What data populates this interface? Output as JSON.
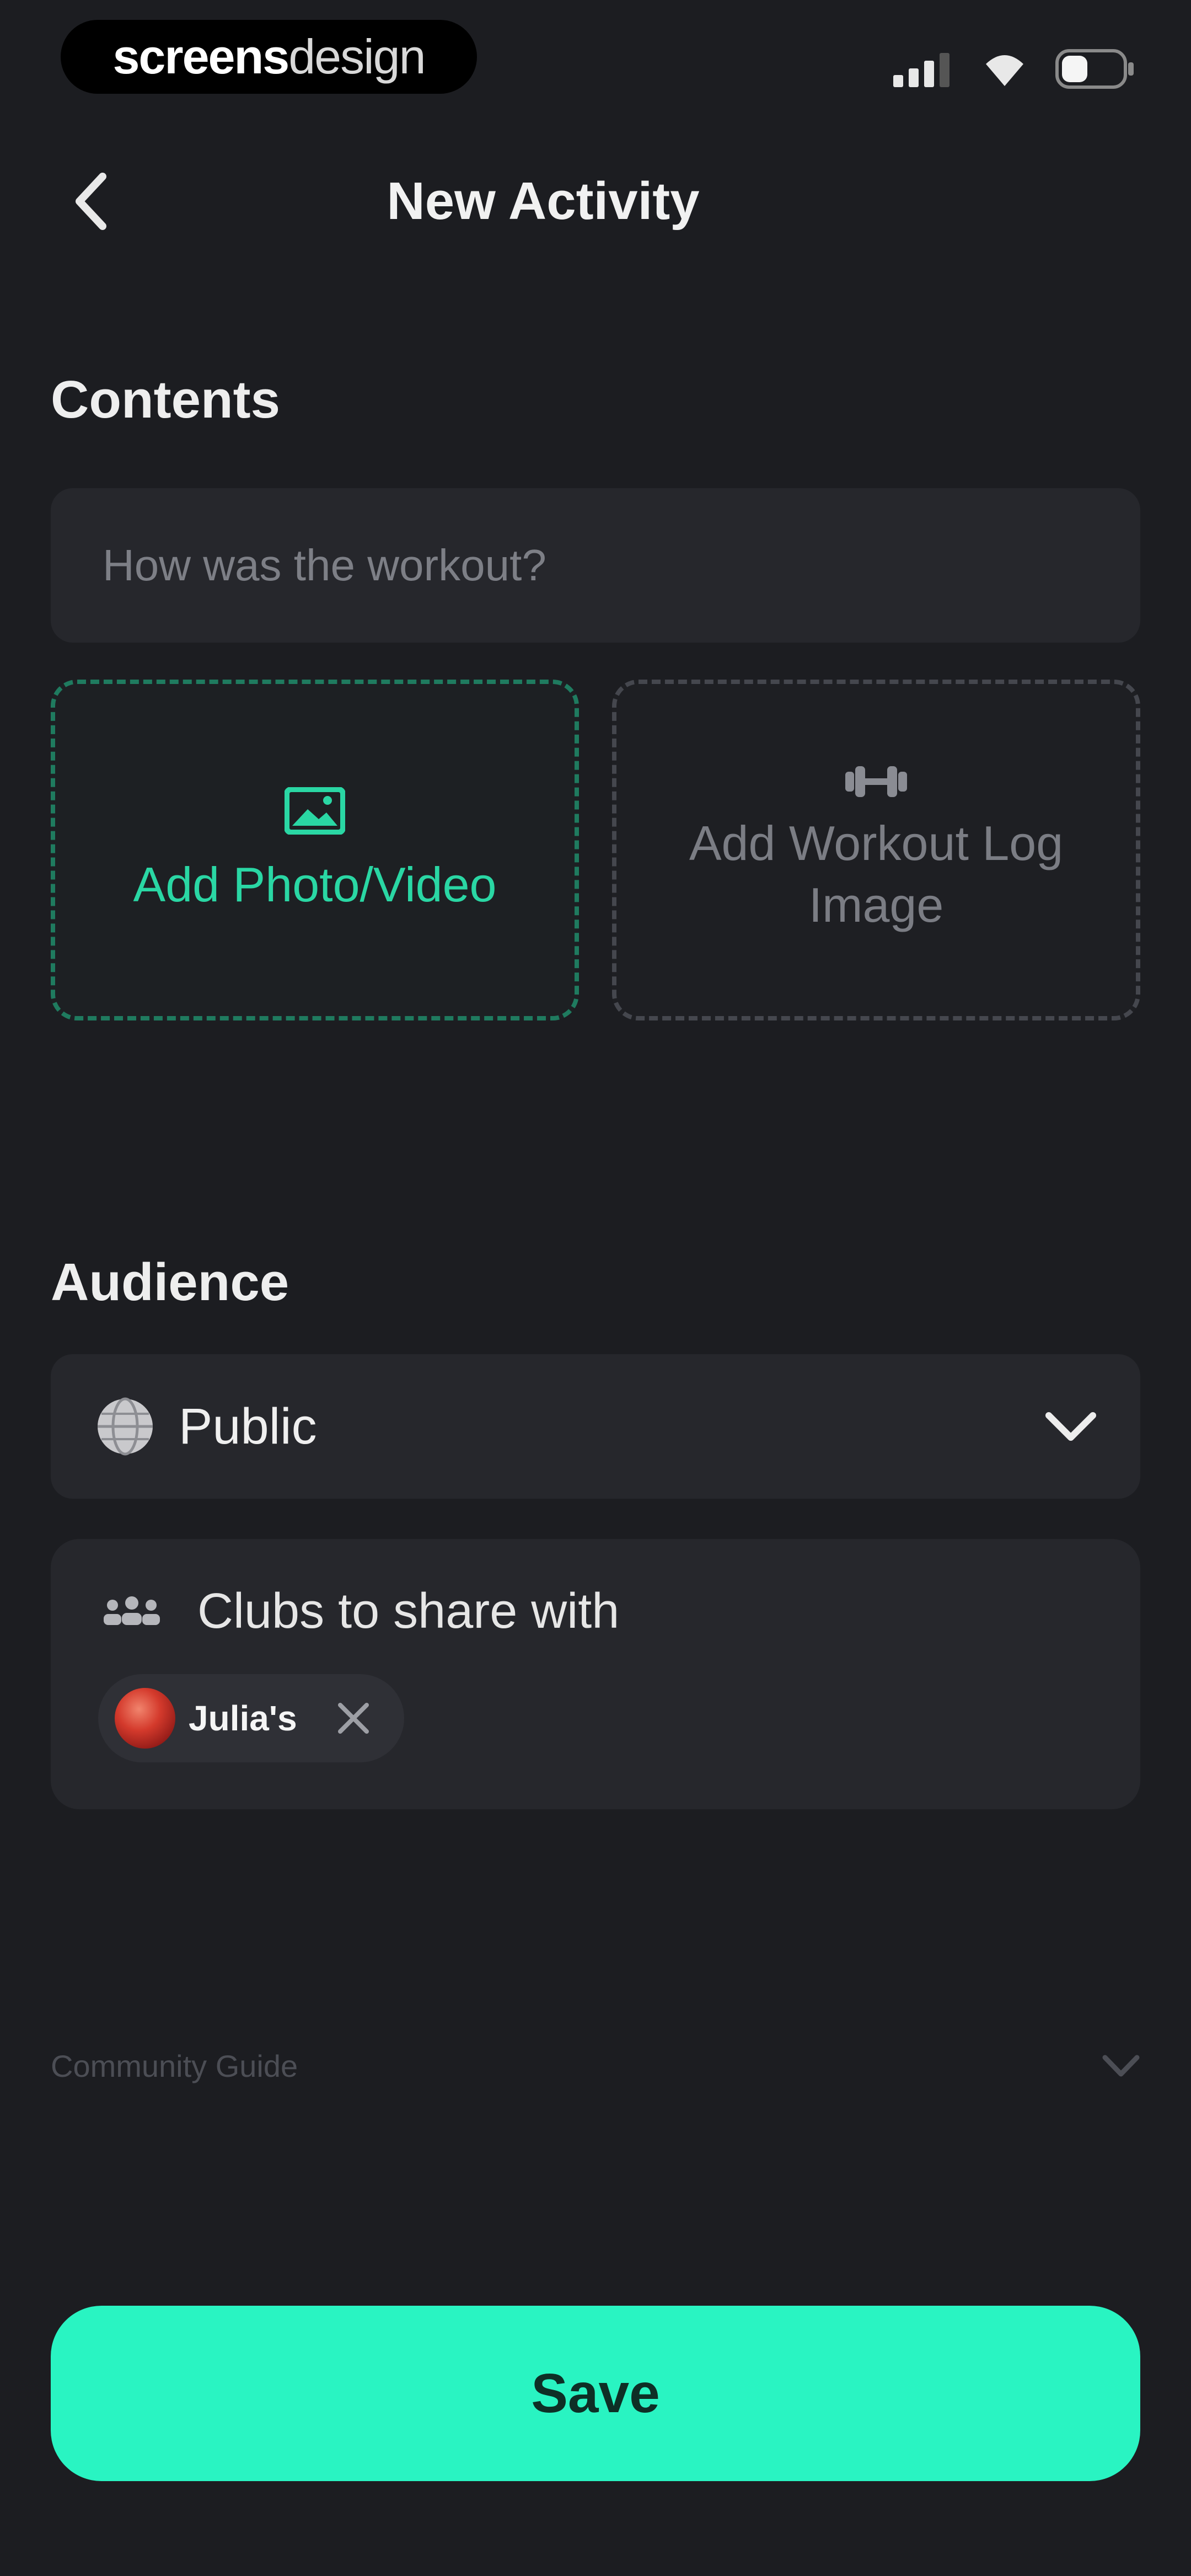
{
  "status_bar": {
    "brand_part1": "screens",
    "brand_part2": "design",
    "icons": [
      "signal-icon",
      "wifi-icon",
      "battery-icon"
    ]
  },
  "header": {
    "back_icon": "chevron-left-icon",
    "title": "New Activity"
  },
  "contents": {
    "heading": "Contents",
    "input_placeholder": "How was the workout?",
    "input_value": "",
    "add_media": {
      "icon": "image-icon",
      "label": "Add Photo/Video"
    },
    "add_log": {
      "icon": "dumbbell-icon",
      "label_line1": "Add Workout Log",
      "label_line2": "Image"
    }
  },
  "audience": {
    "heading": "Audience",
    "visibility": {
      "icon": "globe-icon",
      "value": "Public",
      "chevron": "chevron-down-icon"
    },
    "clubs": {
      "icon": "group-icon",
      "label": "Clubs to share with",
      "chips": [
        {
          "name": "Julia's",
          "remove_icon": "close-icon"
        }
      ]
    }
  },
  "community_guide": {
    "label": "Community Guide",
    "chevron": "chevron-down-icon"
  },
  "footer": {
    "save_label": "Save"
  },
  "colors": {
    "background": "#1c1d21",
    "surface": "#26272c",
    "accent": "#29f4c2",
    "accent_text": "#2ad7a4",
    "muted": "#7b7d84"
  }
}
